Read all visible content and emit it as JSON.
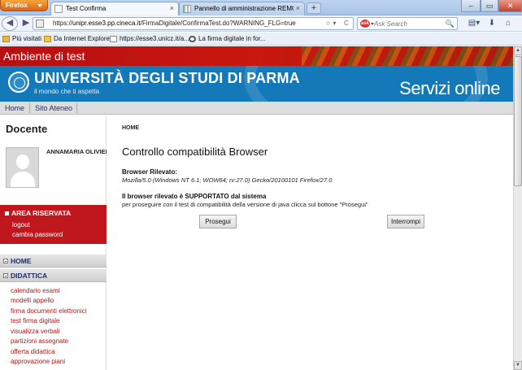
{
  "browser": {
    "menu_label": "Firefox",
    "tabs": [
      {
        "label": "Test Confirma",
        "active": true
      },
      {
        "label": "Pannello di amministrazione REMOT...",
        "active": false
      }
    ],
    "new_tab_label": "+",
    "window_controls": {
      "minimize": "–",
      "maximize": "▭",
      "close": "✕"
    },
    "back_glyph": "◀",
    "forward_glyph": "▶",
    "url": {
      "prefix": "https://",
      "host": "unipr.esse3.pp.cineca.it",
      "path": "/FirmaDigitale/ConfirmaTest.do?WARNING_FLG=true"
    },
    "url_controls": {
      "dropdown": "☆ ▾",
      "reload": "C"
    },
    "search": {
      "engine": "ask",
      "placeholder": "Ask Search",
      "go": "🔍"
    },
    "toolbar_icons": {
      "bookmarks_menu": "▤▾",
      "downloads": "⬇",
      "home": "⌂"
    },
    "bookmarks": [
      {
        "label": "Più visitati",
        "icon": "folder-icon"
      },
      {
        "label": "Da Internet Explorer",
        "icon": "ie-folder-icon"
      },
      {
        "label": "https://esse3.unicz.it/a...",
        "icon": "page-icon"
      },
      {
        "label": "La firma digitale in for...",
        "icon": "seal-icon"
      }
    ]
  },
  "page": {
    "environment_title": "Ambiente di test",
    "university_name": "UNIVERSITÀ DEGLI STUDI DI PARMA",
    "tagline": "il mondo che ti aspetta",
    "services_title": "Servizi online",
    "top_nav": [
      "Home",
      "Sito Ateneo"
    ],
    "sidebar": {
      "role_title": "Docente",
      "user_name": "ANNAMARIA OLIVIERI",
      "reserved_area": {
        "title": "AREA RISERVATA",
        "links": [
          "logout",
          "cambia password"
        ]
      },
      "sections": [
        {
          "label": "HOME"
        },
        {
          "label": "DIDATTICA"
        }
      ],
      "didattica_links": [
        "calendario esami",
        "modelli appello",
        "firma documenti elettronici",
        "test firma digitale",
        "visualizza verbali",
        "partizioni assegnate",
        "offerta didattica",
        "approvazione piani"
      ]
    },
    "main": {
      "breadcrumb": "HOME",
      "title": "Controllo compatibilità Browser",
      "browser_detected_label": "Browser Rilevato:",
      "browser_detected_value": "Mozilla/5.0 (Windows NT 6.1; WOW64; rv:27.0) Gecko/20100101 Firefox/27.0",
      "supported_message": "Il browser rilevato è SUPPORTATO dal sistema",
      "instructions": "per proseguire con il test di compatibilità della versione di java clicca sul bottone \"Prosegui\"",
      "buttons": {
        "continue": "Prosegui",
        "stop": "Interrompi"
      }
    }
  }
}
